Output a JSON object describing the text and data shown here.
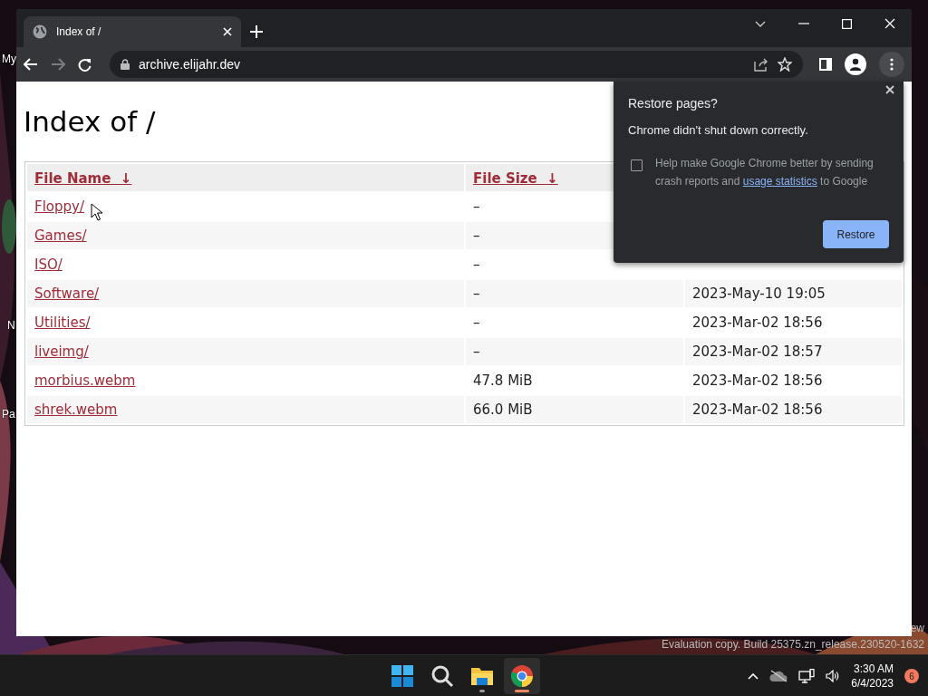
{
  "desktop": {
    "labels": [
      "My",
      "N",
      "Pa"
    ],
    "corner_text": "ew",
    "watermark": "Evaluation copy. Build 25375.zn_release.230520-1632"
  },
  "browser": {
    "tabs": [
      {
        "title": "Index of /",
        "selected": true
      }
    ],
    "address": "archive.elijahr.dev"
  },
  "page": {
    "heading": "Index of /",
    "table": {
      "columns": [
        "File Name  ↓",
        "File Size  ↓"
      ],
      "rows": [
        {
          "name": "Floppy/",
          "size": "–"
        },
        {
          "name": "Games/",
          "size": "–"
        },
        {
          "name": "ISO/",
          "size": "–"
        },
        {
          "name": "Software/",
          "size": "–",
          "date": "2023-May-10 19:05"
        },
        {
          "name": "Utilities/",
          "size": "–",
          "date": "2023-Mar-02 18:56"
        },
        {
          "name": "liveimg/",
          "size": "–",
          "date": "2023-Mar-02 18:57"
        },
        {
          "name": "morbius.webm",
          "size": "47.8 MiB",
          "date": "2023-Mar-02 18:56"
        },
        {
          "name": "shrek.webm",
          "size": "66.0 MiB",
          "date": "2023-Mar-02 18:56"
        }
      ]
    }
  },
  "popup": {
    "title": "Restore pages?",
    "message": "Chrome didn't shut down correctly.",
    "consent": {
      "checked": false,
      "before": "Help make Google Chrome better by sending crash reports and ",
      "link": "usage statistics",
      "after": " to Google"
    },
    "button": "Restore"
  },
  "taskbar": {
    "apps": [
      {
        "kind": "start",
        "running": false,
        "selected": false
      },
      {
        "kind": "search",
        "running": false,
        "selected": false
      },
      {
        "kind": "explorer",
        "running": true,
        "selected": false
      },
      {
        "kind": "chrome",
        "running": true,
        "selected": true
      }
    ],
    "time": "3:30 AM",
    "date": "6/4/2023",
    "badge": "6"
  }
}
